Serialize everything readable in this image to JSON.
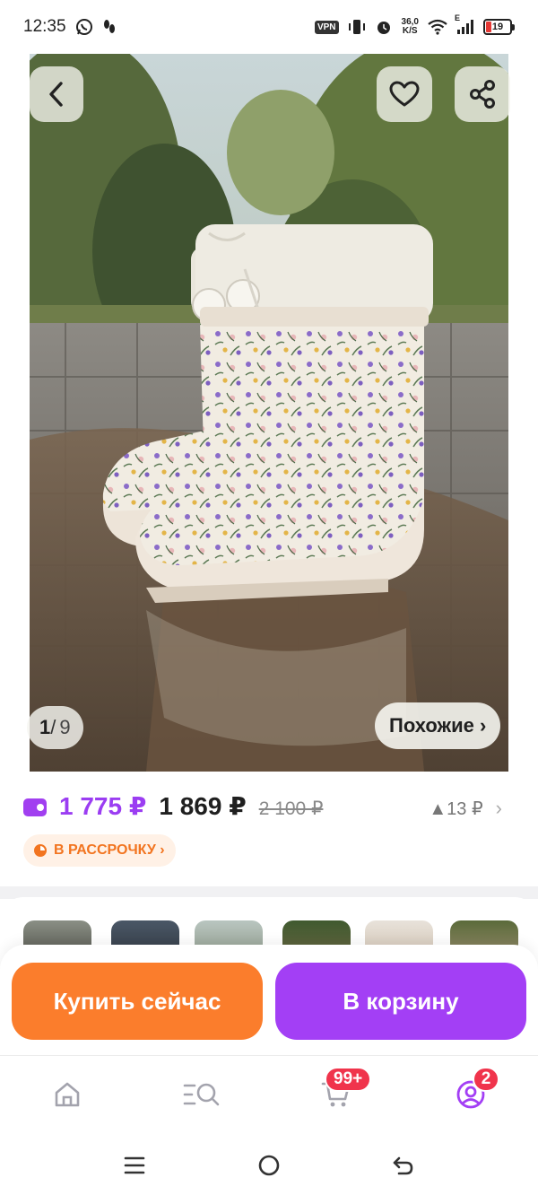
{
  "status_bar": {
    "time": "12:35",
    "vpn_label": "VPN",
    "net_speed_value": "36,0",
    "net_speed_unit": "K/S",
    "network_type": "E",
    "battery_level": "19"
  },
  "gallery": {
    "counter_current": "1",
    "counter_separator": "/",
    "counter_total": "9",
    "similar_label": "Похожие ›"
  },
  "price": {
    "wallet_price": "1 775 ₽",
    "price": "1 869 ₽",
    "old_price": "2 100 ₽",
    "delta": "▲13 ₽",
    "installment_label": "В РАССРОЧКУ ›"
  },
  "actions": {
    "buy_now": "Купить сейчас",
    "add_to_cart": "В корзину"
  },
  "bottom_nav": {
    "cart_badge": "99+",
    "profile_badge": "2"
  },
  "colors": {
    "accent_purple": "#a33ff5",
    "accent_orange": "#fb7d2c",
    "badge_red": "#f0344c"
  },
  "icons": [
    "back-arrow-icon",
    "heart-icon",
    "share-icon",
    "home-icon",
    "catalog-search-icon",
    "cart-icon",
    "profile-icon",
    "menu-icon",
    "circle-home-icon",
    "back-gesture-icon"
  ]
}
